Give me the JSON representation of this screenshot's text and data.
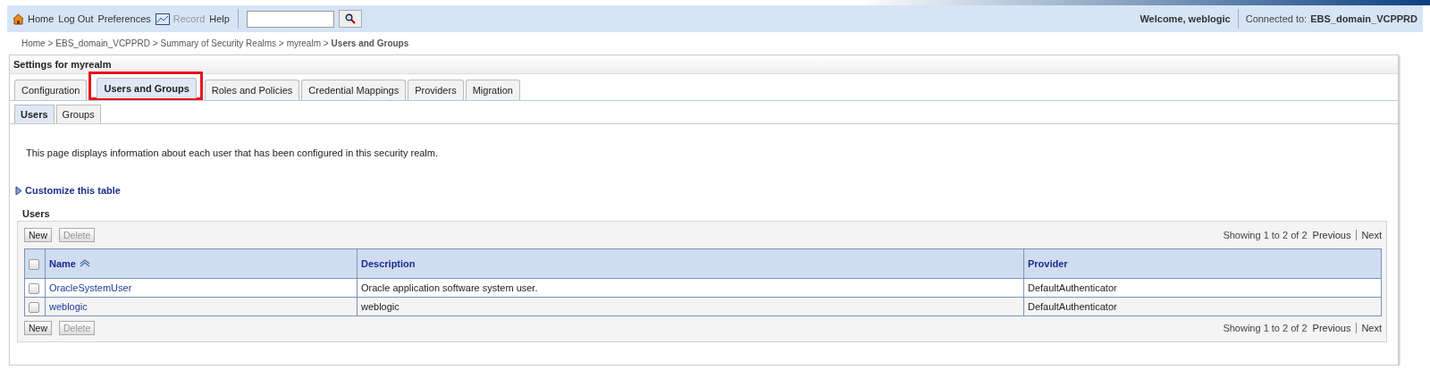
{
  "toolbar": {
    "links": [
      {
        "label": "Home",
        "kind": "home",
        "disabled": false
      },
      {
        "label": "Log Out",
        "kind": "plain",
        "disabled": false
      },
      {
        "label": "Preferences",
        "kind": "plain",
        "disabled": false
      },
      {
        "label": "Record",
        "kind": "record",
        "disabled": true
      },
      {
        "label": "Help",
        "kind": "plain",
        "disabled": false
      }
    ],
    "welcome": "Welcome, weblogic",
    "connected_label": "Connected to:",
    "connected_value": "EBS_domain_VCPPRD"
  },
  "breadcrumb": [
    {
      "label": "Home >",
      "current": false
    },
    {
      "label": "EBS_domain_VCPPRD >",
      "current": false
    },
    {
      "label": "Summary of Security Realms >",
      "current": false
    },
    {
      "label": "myrealm >",
      "current": false
    },
    {
      "label": "Users and Groups",
      "current": true
    }
  ],
  "panel": {
    "title": "Settings for myrealm",
    "tabs": [
      {
        "label": "Configuration",
        "selected": false,
        "highlighted": false
      },
      {
        "label": "Users and Groups",
        "selected": true,
        "highlighted": true
      },
      {
        "label": "Roles and Policies",
        "selected": false,
        "highlighted": false
      },
      {
        "label": "Credential Mappings",
        "selected": false,
        "highlighted": false
      },
      {
        "label": "Providers",
        "selected": false,
        "highlighted": false
      },
      {
        "label": "Migration",
        "selected": false,
        "highlighted": false
      }
    ],
    "subtabs": [
      {
        "label": "Users",
        "selected": true
      },
      {
        "label": "Groups",
        "selected": false
      }
    ],
    "description": "This page displays information about each user that has been configured in this security realm.",
    "customize_link": "Customize this table",
    "table": {
      "title": "Users",
      "controls": [
        {
          "buttons": [
            {
              "label": "New",
              "disabled": false
            },
            {
              "label": "Delete",
              "disabled": true
            }
          ],
          "pager": {
            "showing": "Showing 1 to 2 of 2",
            "previous": "Previous",
            "next": "Next"
          }
        },
        {
          "buttons": [
            {
              "label": "New",
              "disabled": false
            },
            {
              "label": "Delete",
              "disabled": true
            }
          ],
          "pager": {
            "showing": "Showing 1 to 2 of 2",
            "previous": "Previous",
            "next": "Next"
          }
        }
      ],
      "select_all_checked": false,
      "columns": [
        {
          "label": "Name",
          "sorted": true
        },
        {
          "label": "Description",
          "sorted": false
        },
        {
          "label": "Provider",
          "sorted": false
        }
      ],
      "rows": [
        {
          "checked": false,
          "name": "OracleSystemUser",
          "description": "Oracle application software system user.",
          "provider": "DefaultAuthenticator"
        },
        {
          "checked": false,
          "name": "weblogic",
          "description": "weblogic",
          "provider": "DefaultAuthenticator"
        }
      ]
    }
  }
}
